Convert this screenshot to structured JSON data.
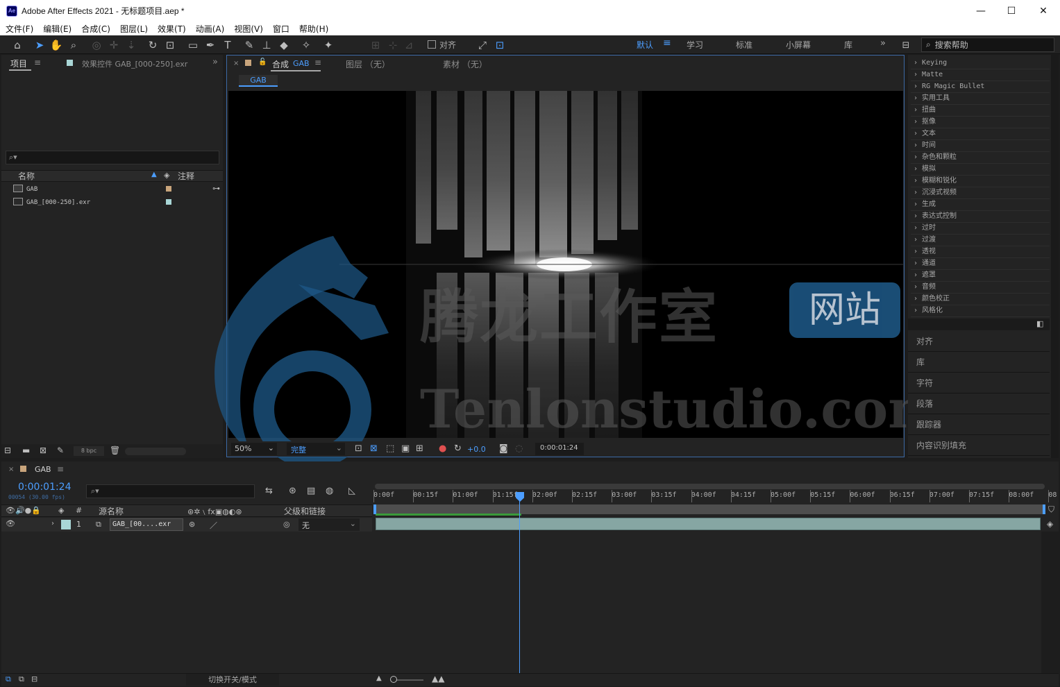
{
  "window": {
    "title": "Adobe After Effects 2021 - 无标题项目.aep *",
    "logo_text": "Ae",
    "minimize": "—",
    "maximize": "☐",
    "close": "✕"
  },
  "menu": [
    "文件(F)",
    "编辑(E)",
    "合成(C)",
    "图层(L)",
    "效果(T)",
    "动画(A)",
    "视图(V)",
    "窗口",
    "帮助(H)"
  ],
  "toolbar": {
    "align_label": "对齐",
    "workspaces": [
      "默认",
      "学习",
      "标准",
      "小屏幕",
      "库"
    ],
    "active_workspace": "默认",
    "search_help_placeholder": "搜索帮助"
  },
  "project": {
    "tab_project": "项目",
    "tab_effects": "效果控件 GAB_[000-250].exr",
    "columns": {
      "name": "名称",
      "comment": "注释"
    },
    "items": [
      {
        "name": "GAB",
        "color": "#c9a57c"
      },
      {
        "name": "GAB_[000-250].exr",
        "color": "#a9d6d6"
      }
    ],
    "bpc": "8 bpc"
  },
  "composition": {
    "tab_label": "合成",
    "tab_name": "GAB",
    "layer_tab": "图层 （无）",
    "footage_tab": "素材 （无）",
    "breadcrumb": "GAB",
    "zoom": "50%",
    "resolution": "完整",
    "exposure": "+0.0",
    "timecode": "0:00:01:24"
  },
  "watermark": {
    "cn_text": "腾龙工作室",
    "badge_text": "网站",
    "url_text": "Tenlonstudio.com"
  },
  "effects": {
    "categories": [
      "Keying",
      "Matte",
      "RG Magic Bullet",
      "实用工具",
      "扭曲",
      "抠像",
      "文本",
      "时间",
      "杂色和颗粒",
      "模拟",
      "模糊和锐化",
      "沉浸式视频",
      "生成",
      "表达式控制",
      "过时",
      "过渡",
      "透视",
      "通道",
      "遮罩",
      "音频",
      "颜色校正",
      "风格化"
    ],
    "panels": [
      "对齐",
      "库",
      "字符",
      "段落",
      "跟踪器",
      "内容识别填充"
    ]
  },
  "timeline": {
    "comp_name": "GAB",
    "timecode": "0:00:01:24",
    "frame_info": "00054 (30.00 fps)",
    "col_number": "#",
    "col_source": "源名称",
    "col_parent": "父级和链接",
    "layer": {
      "index": "1",
      "name": "GAB_[00....exr",
      "parent": "无"
    },
    "ruler": [
      "0:00f",
      "00:15f",
      "01:00f",
      "01:15f",
      "02:00f",
      "02:15f",
      "03:00f",
      "03:15f",
      "04:00f",
      "04:15f",
      "05:00f",
      "05:15f",
      "06:00f",
      "06:15f",
      "07:00f",
      "07:15f",
      "08:00f",
      "08"
    ],
    "toggle_label": "切换开关/模式"
  }
}
